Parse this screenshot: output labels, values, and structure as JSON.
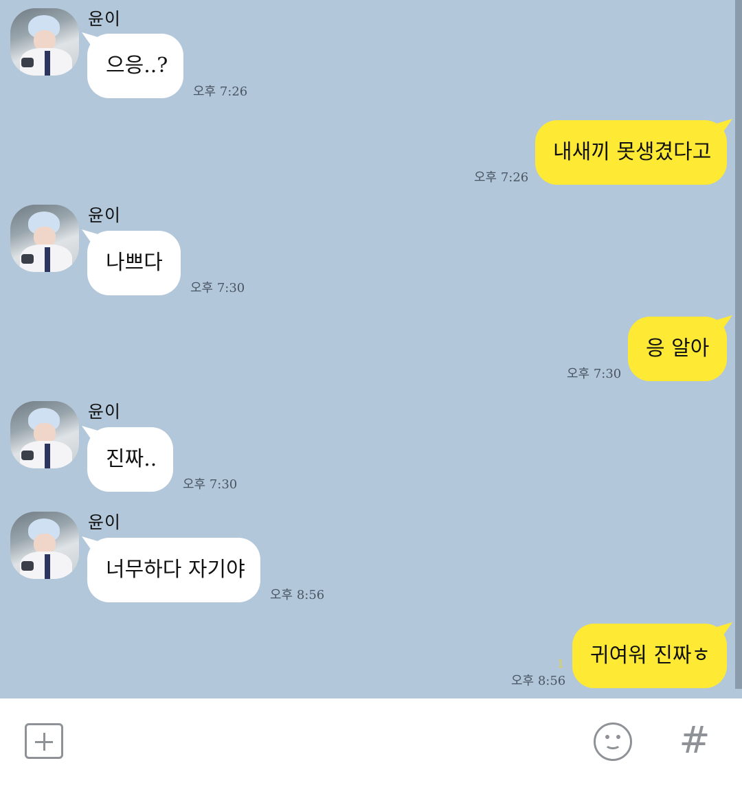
{
  "chat": {
    "contact_name": "윤이",
    "messages": [
      {
        "direction": "in",
        "text": "으응..?",
        "time": "오후 7:26"
      },
      {
        "direction": "out",
        "text": "내새끼 못생겼다고",
        "time": "오후 7:26"
      },
      {
        "direction": "in",
        "text": "나쁘다",
        "time": "오후 7:30"
      },
      {
        "direction": "out",
        "text": "응 알아",
        "time": "오후 7:30"
      },
      {
        "direction": "in",
        "text": "진짜..",
        "time": "오후 7:30"
      },
      {
        "direction": "in",
        "text": "너무하다 자기야",
        "time": "오후 8:56"
      },
      {
        "direction": "out",
        "text": "귀여워 진짜ㅎ",
        "time": "오후 8:56",
        "unread": "1"
      }
    ]
  },
  "input_bar": {
    "attach_icon": "plus-square-icon",
    "emoji_icon": "smiley-icon",
    "hashtag_label": "#"
  },
  "colors": {
    "chat_background": "#b2c7d9",
    "incoming_bubble": "#ffffff",
    "outgoing_bubble": "#fee934",
    "unread_count": "#e5d23a"
  }
}
